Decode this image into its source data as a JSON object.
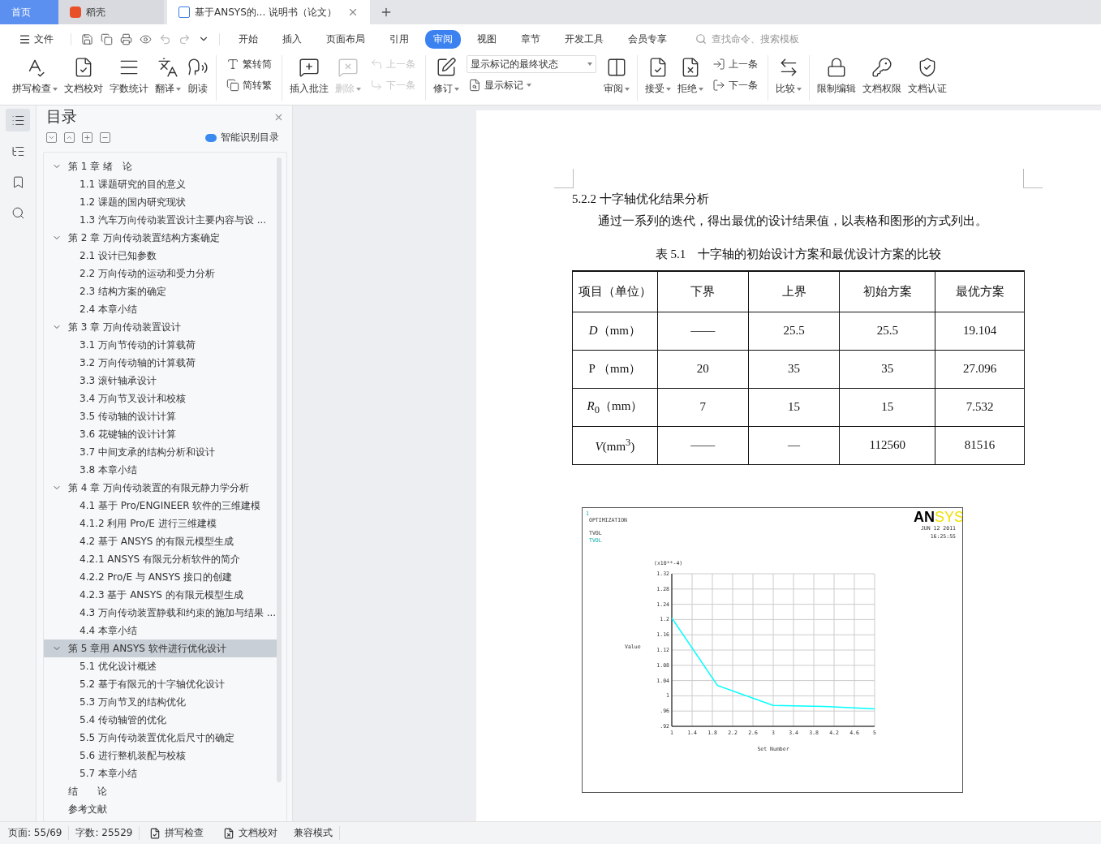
{
  "tabs": [
    {
      "kind": "home",
      "label": "首页",
      "selected": false
    },
    {
      "kind": "app",
      "label": "稻壳",
      "selected": false
    },
    {
      "kind": "doc",
      "label": "基于ANSYS的... 说明书（论文）",
      "selected": true
    }
  ],
  "menu": {
    "file": "文件",
    "items": [
      {
        "label": "开始",
        "selected": false
      },
      {
        "label": "插入",
        "selected": false
      },
      {
        "label": "页面布局",
        "selected": false
      },
      {
        "label": "引用",
        "selected": false
      },
      {
        "label": "审阅",
        "selected": true
      },
      {
        "label": "视图",
        "selected": false
      },
      {
        "label": "章节",
        "selected": false
      },
      {
        "label": "开发工具",
        "selected": false
      },
      {
        "label": "会员专享",
        "selected": false
      }
    ],
    "search": {
      "placeholder": "查找命令、搜索模板"
    }
  },
  "ribbon": [
    {
      "columns": [
        {
          "kind": "large",
          "label": "拼写检查",
          "dropdown": true,
          "disabled": false
        },
        {
          "kind": "large",
          "label": "文档校对",
          "dropdown": false,
          "disabled": false
        },
        {
          "kind": "large",
          "label": "字数统计",
          "dropdown": false,
          "disabled": false
        },
        {
          "kind": "large",
          "label": "翻译",
          "dropdown": true,
          "disabled": false
        },
        {
          "kind": "large",
          "label": "朗读",
          "dropdown": false,
          "disabled": false
        }
      ]
    },
    {
      "columns": [
        {
          "kind": "stack",
          "items": [
            {
              "kind": "small",
              "label": "繁转简",
              "dropdown": false,
              "disabled": false
            },
            {
              "kind": "small",
              "label": "简转繁",
              "dropdown": false,
              "disabled": false
            }
          ]
        }
      ]
    },
    {
      "columns": [
        {
          "kind": "large",
          "label": "插入批注",
          "dropdown": false,
          "disabled": false
        },
        {
          "kind": "large",
          "label": "删除",
          "dropdown": true,
          "disabled": true
        },
        {
          "kind": "stack",
          "items": [
            {
              "kind": "small",
              "label": "上一条",
              "dropdown": false,
              "disabled": true
            },
            {
              "kind": "small",
              "label": "下一条",
              "dropdown": false,
              "disabled": true
            }
          ]
        }
      ]
    },
    {
      "columns": [
        {
          "kind": "large",
          "label": "修订",
          "dropdown": true,
          "disabled": false
        },
        {
          "kind": "stack",
          "items": [
            {
              "kind": "select",
              "label": "显示标记的最终状态",
              "dropdown": true,
              "disabled": false
            },
            {
              "kind": "small",
              "label": "显示标记",
              "dropdown": true,
              "disabled": false
            }
          ]
        },
        {
          "kind": "large",
          "label": "审阅",
          "dropdown": true,
          "disabled": false
        }
      ]
    },
    {
      "columns": [
        {
          "kind": "large",
          "label": "接受",
          "dropdown": true,
          "disabled": false
        },
        {
          "kind": "large",
          "label": "拒绝",
          "dropdown": true,
          "disabled": false
        },
        {
          "kind": "stack",
          "items": [
            {
              "kind": "small",
              "label": "上一条",
              "dropdown": false,
              "disabled": false
            },
            {
              "kind": "small",
              "label": "下一条",
              "dropdown": false,
              "disabled": false
            }
          ]
        }
      ]
    },
    {
      "columns": [
        {
          "kind": "large",
          "label": "比较",
          "dropdown": true,
          "disabled": false
        }
      ]
    },
    {
      "columns": [
        {
          "kind": "large",
          "label": "限制编辑",
          "dropdown": false,
          "disabled": false
        },
        {
          "kind": "large",
          "label": "文档权限",
          "dropdown": false,
          "disabled": false
        },
        {
          "kind": "large",
          "label": "文档认证",
          "dropdown": false,
          "disabled": false
        }
      ]
    }
  ],
  "rail": [
    {
      "selected": true
    },
    {
      "selected": false
    },
    {
      "selected": false
    },
    {
      "selected": false
    }
  ],
  "toc": {
    "title": "目录",
    "smart": "智能识别目录",
    "items": [
      {
        "label": "第 1 章  绪　论",
        "selected": false,
        "expanded": true,
        "children": [
          {
            "label": "1.1  课题研究的目的意义",
            "selected": false
          },
          {
            "label": "1.2  课题的国内研究现状",
            "selected": false
          },
          {
            "label": "1.3  汽车万向传动装置设计主要内容与设 ...",
            "selected": false
          }
        ]
      },
      {
        "label": "第 2 章  万向传动装置结构方案确定",
        "selected": false,
        "expanded": true,
        "children": [
          {
            "label": "2.1  设计已知参数",
            "selected": false
          },
          {
            "label": "2.2  万向传动的运动和受力分析",
            "selected": false
          },
          {
            "label": "2.3  结构方案的确定",
            "selected": false
          },
          {
            "label": "2.4  本章小结",
            "selected": false
          }
        ]
      },
      {
        "label": "第 3 章  万向传动装置设计",
        "selected": false,
        "expanded": true,
        "children": [
          {
            "label": "3.1  万向节传动的计算载荷",
            "selected": false
          },
          {
            "label": "3.2  万向传动轴的计算载荷",
            "selected": false
          },
          {
            "label": "3.3  滚针轴承设计",
            "selected": false
          },
          {
            "label": "3.4  万向节叉设计和校核",
            "selected": false
          },
          {
            "label": "3.5  传动轴的设计计算",
            "selected": false
          },
          {
            "label": "3.6  花键轴的设计计算",
            "selected": false
          },
          {
            "label": "3.7  中间支承的结构分析和设计",
            "selected": false
          },
          {
            "label": "3.8  本章小结",
            "selected": false
          }
        ]
      },
      {
        "label": "第  4  章    万向传动装置的有限元静力学分析",
        "selected": false,
        "expanded": true,
        "children": [
          {
            "label": "4.1  基于 Pro/ENGINEER 软件的三维建模",
            "selected": false
          },
          {
            "label": "4.1.2 利用 Pro/E 进行三维建模",
            "selected": false
          },
          {
            "label": "4.2  基于 ANSYS 的有限元模型生成",
            "selected": false
          },
          {
            "label": "4.2.1 ANSYS 有限元分析软件的简介",
            "selected": false
          },
          {
            "label": "4.2.2    Pro/E 与 ANSYS 接口的创建",
            "selected": false
          },
          {
            "label": "4.2.3    基于 ANSYS 的有限元模型生成",
            "selected": false
          },
          {
            "label": "4.3 万向传动装置静载和约束的施加与结果 ...",
            "selected": false
          },
          {
            "label": "4.4  本章小结",
            "selected": false
          }
        ]
      },
      {
        "label": "第 5 章用 ANSYS 软件进行优化设计",
        "selected": true,
        "expanded": true,
        "children": [
          {
            "label": "5.1 优化设计概述",
            "selected": false
          },
          {
            "label": "5.2    基于有限元的十字轴优化设计",
            "selected": false
          },
          {
            "label": "5.3    万向节叉的结构优化",
            "selected": false
          },
          {
            "label": "5.4    传动轴管的优化",
            "selected": false
          },
          {
            "label": "5.5  万向传动装置优化后尺寸的确定",
            "selected": false
          },
          {
            "label": "5.6  进行整机装配与校核",
            "selected": false
          },
          {
            "label": "5.7    本章小结",
            "selected": false
          }
        ]
      },
      {
        "label": "结　　论",
        "selected": false
      },
      {
        "label": "参考文献",
        "selected": false
      }
    ]
  },
  "document": {
    "heading": "5.2.2 十字轴优化结果分析",
    "paragraph": "通过一系列的迭代，得出最优的设计结果值，以表格和图形的方式列出。",
    "table_caption": "表 5.1　十字轴的初始设计方案和最优设计方案的比较",
    "table": {
      "columns": [
        "项目（单位）",
        "下界",
        "上界",
        "初始方案",
        "最优方案"
      ],
      "rows": [
        [
          "*D*（mm）",
          "——",
          "25.5",
          "25.5",
          "19.104"
        ],
        [
          "P （mm）",
          "20",
          "35",
          "35",
          "27.096"
        ],
        [
          "*R*$_{0}$（mm）",
          "7",
          "15",
          "15",
          "7.532"
        ],
        [
          "*V*(mm$^{3}$)",
          "——",
          "—",
          "112560",
          "81516"
        ]
      ]
    },
    "figure": {
      "number": "1",
      "title": "OPTIMIZATION",
      "label_1": "TVOL",
      "logo": {
        "part_1": "AN",
        "part_2": "SYS"
      },
      "date": "JUN 12 2011",
      "time": "16:25:55",
      "chart_data": {
        "type": "line",
        "xlabel": "Set Number",
        "ylabel": "Value",
        "title": "(x10**-4)",
        "x": [
          1,
          1.9,
          3,
          4,
          5
        ],
        "series": [
          {
            "name": "TVOL",
            "color": "#00ffff",
            "values": [
              1.204,
              1.027,
              0.975,
              0.972,
              0.966
            ]
          }
        ],
        "xlim": [
          1,
          5
        ],
        "ylim": [
          0.92,
          1.32
        ],
        "grid": true,
        "xticks": [
          1,
          1.4,
          1.8,
          2.2,
          2.6,
          3,
          3.4,
          3.8,
          4.2,
          4.6,
          5
        ],
        "yticks": [
          {
            "value": 0.92,
            "label": ".92"
          },
          {
            "value": 0.96,
            "label": ".96"
          },
          {
            "value": 1,
            "label": "1"
          },
          {
            "value": 1.04,
            "label": "1.04"
          },
          {
            "value": 1.08,
            "label": "1.08"
          },
          {
            "value": 1.12,
            "label": "1.12"
          },
          {
            "value": 1.16,
            "label": "1.16"
          },
          {
            "value": 1.2,
            "label": "1.2"
          },
          {
            "value": 1.24,
            "label": "1.24"
          },
          {
            "value": 1.28,
            "label": "1.28"
          },
          {
            "value": 1.32,
            "label": "1.32"
          }
        ]
      }
    }
  },
  "status_bar": {
    "page": "页面: 55/69",
    "words": "字数: 25529",
    "spell": "拼写检查",
    "proof": "文档校对",
    "mode": "兼容模式"
  }
}
